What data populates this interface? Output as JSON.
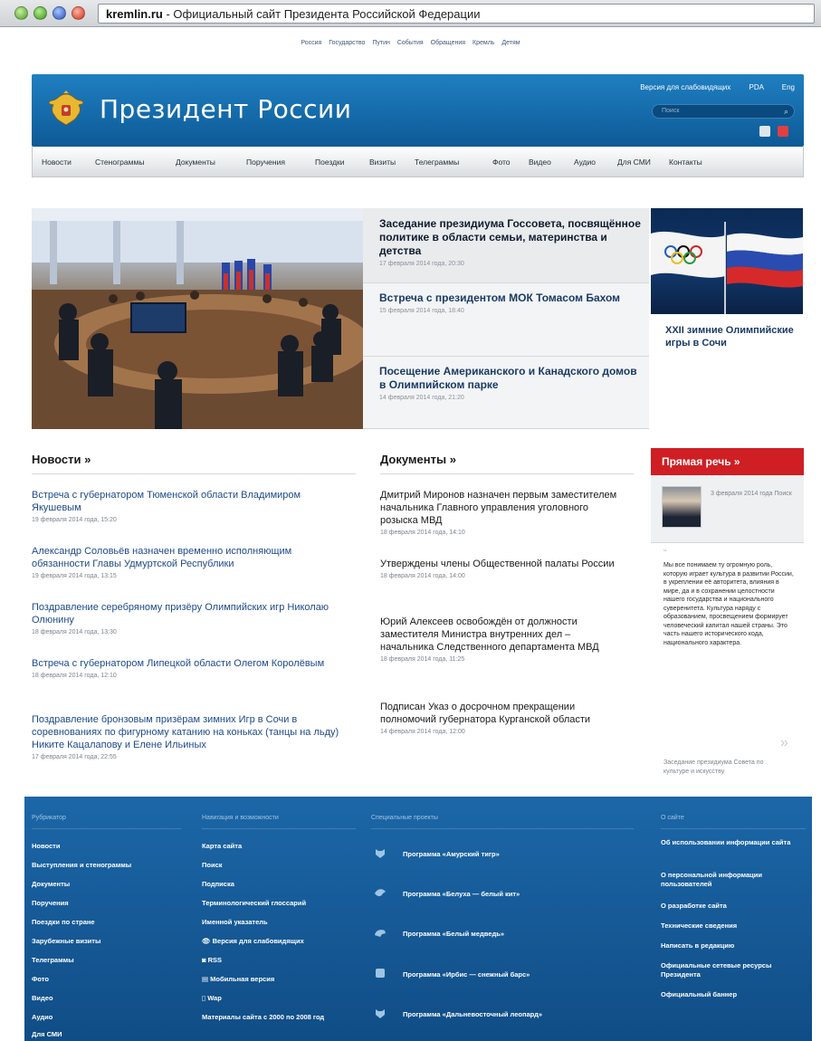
{
  "browser": {
    "domain": "kremlin.ru",
    "title": " - Официальный сайт Президента Российской Федерации"
  },
  "top_links": [
    "Россия",
    "Государство",
    "Путин",
    "События",
    "Обращения",
    "Кремль",
    "Детям"
  ],
  "header": {
    "site_title": "Президент России",
    "links": [
      "Версия для слабовидящих",
      "PDA",
      "Eng"
    ],
    "search_placeholder": "Поиск"
  },
  "nav": [
    "Новости",
    "Стенограммы",
    "Документы",
    "Поручения",
    "Поездки",
    "Визиты",
    "Телеграммы",
    "Фото",
    "Видео",
    "Аудио",
    "Для СМИ",
    "Контакты"
  ],
  "hero": {
    "items": [
      {
        "title": "Заседание президиума Госсовета, посвящённое политике в области семьи, материнства и детства",
        "date": "17 февраля 2014 года, 20:30"
      },
      {
        "title": "Встреча с президентом МОК Томасом Бахом",
        "date": "15 февраля 2014 года, 18:40"
      },
      {
        "title": "Посещение Американского и Канадского домов в Олимпийском парке",
        "date": "14 февраля 2014 года, 21:20"
      }
    ],
    "side_title": "XXII зимние Олимпийские игры в Сочи"
  },
  "news": {
    "heading": "Новости »",
    "items": [
      {
        "title": "Встреча с губернатором Тюменской области Владимиром Якушевым",
        "date": "19 февраля 2014 года, 15:20"
      },
      {
        "title": "Александр Соловьёв назначен временно исполняющим обязанности Главы Удмуртской Республики",
        "date": "19 февраля 2014 года, 13:15"
      },
      {
        "title": "Поздравление серебряному призёру Олимпийских игр Николаю Олюнину",
        "date": "18 февраля 2014 года, 13:30"
      },
      {
        "title": "Встреча с губернатором Липецкой области Олегом Королёвым",
        "date": "18 февраля 2014 года, 12:10"
      },
      {
        "title": "Поздравление бронзовым призёрам зимних Игр в Сочи в соревнованиях по фигурному катанию на коньках (танцы на льду) Никите Кацалапову и Елене Ильиных",
        "date": "17 февраля 2014 года, 22:55"
      }
    ]
  },
  "documents": {
    "heading": "Документы »",
    "items": [
      {
        "title": "Дмитрий Миронов назначен первым заместителем начальника Главного управления уголовного розыска МВД",
        "date": "18 февраля 2014 года, 14:10"
      },
      {
        "title": "Утверждены члены Общественной палаты России",
        "date": "18 февраля 2014 года, 14:00"
      },
      {
        "title": "Юрий Алексеев освобождён от должности заместителя Министра внутренних дел – начальника Следственного департамента МВД",
        "date": "18 февраля 2014 года, 11:25"
      },
      {
        "title": "Подписан Указ о досрочном прекращении полномочий губернатора Курганской области",
        "date": "14 февраля 2014 года, 12:00"
      }
    ]
  },
  "direct_speech": {
    "heading": "Прямая речь »",
    "date": "3 февраля 2014 года Поиск",
    "quote": "Мы все понимаем ту огромную роль, которую играет культура в развитии России, в укреплении её авторитета, влияния в мире, да и в сохранении целостности нашего государства и национального суверенитета. Культура наряду с образованием, просвещением формирует человеческий капитал нашей страны. Это часть нашего исторического кода, национального характера.",
    "caption": "Заседание президиума Совета по культуре и искусству"
  },
  "footer": {
    "col1": {
      "heading": "Рубрикатор",
      "items": [
        "Новости",
        "Выступления и стенограммы",
        "Документы",
        "Поручения",
        "Поездки по стране",
        "Зарубежные визиты",
        "Телеграммы",
        "Фото",
        "Видео",
        "Аудио",
        "Для СМИ"
      ]
    },
    "col2": {
      "heading": "Навигация и возможности",
      "items": [
        "Карта сайта",
        "Поиск",
        "Подписка",
        "Терминологический глоссарий",
        "Именной указатель",
        "Версия для слабовидящих",
        "RSS",
        "Мобильная версия",
        "Wap",
        "Материалы сайта с 2000 по 2008 год"
      ]
    },
    "col3": {
      "heading": "Специальные проекты",
      "items": [
        "Программа «Амурский тигр»",
        "Программа «Белуха — белый кит»",
        "Программа «Белый медведь»",
        "Программа «Ирбис — снежный барс»",
        "Программа «Дальневосточный леопард»"
      ]
    },
    "col4": {
      "heading": "О сайте",
      "items": [
        "Об использовании информации сайта",
        "О персональной информации пользователей",
        "О разработке сайта",
        "Технические сведения",
        "Написать в редакцию",
        "Официальные сетевые ресурсы Президента",
        "Официальный баннер"
      ]
    }
  }
}
